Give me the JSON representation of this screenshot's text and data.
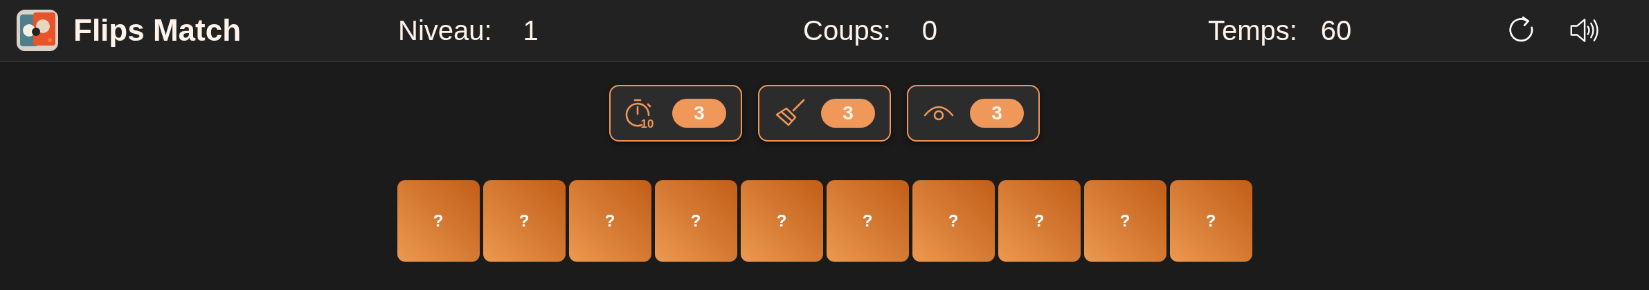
{
  "app": {
    "title": "Flips Match"
  },
  "stats": [
    {
      "label": "Niveau:",
      "value": "1"
    },
    {
      "label": "Coups:",
      "value": "0"
    },
    {
      "label": "Temps:",
      "value": "60"
    }
  ],
  "controls": [
    {
      "kind": "restart"
    },
    {
      "kind": "sound"
    }
  ],
  "powerups": [
    {
      "kind": "timer",
      "icon_text": "10",
      "count": "3"
    },
    {
      "kind": "broom",
      "count": "3"
    },
    {
      "kind": "eye",
      "count": "3"
    }
  ],
  "cards": [
    {
      "label": "?"
    },
    {
      "label": "?"
    },
    {
      "label": "?"
    },
    {
      "label": "?"
    },
    {
      "label": "?"
    },
    {
      "label": "?"
    },
    {
      "label": "?"
    },
    {
      "label": "?"
    },
    {
      "label": "?"
    },
    {
      "label": "?"
    }
  ]
}
